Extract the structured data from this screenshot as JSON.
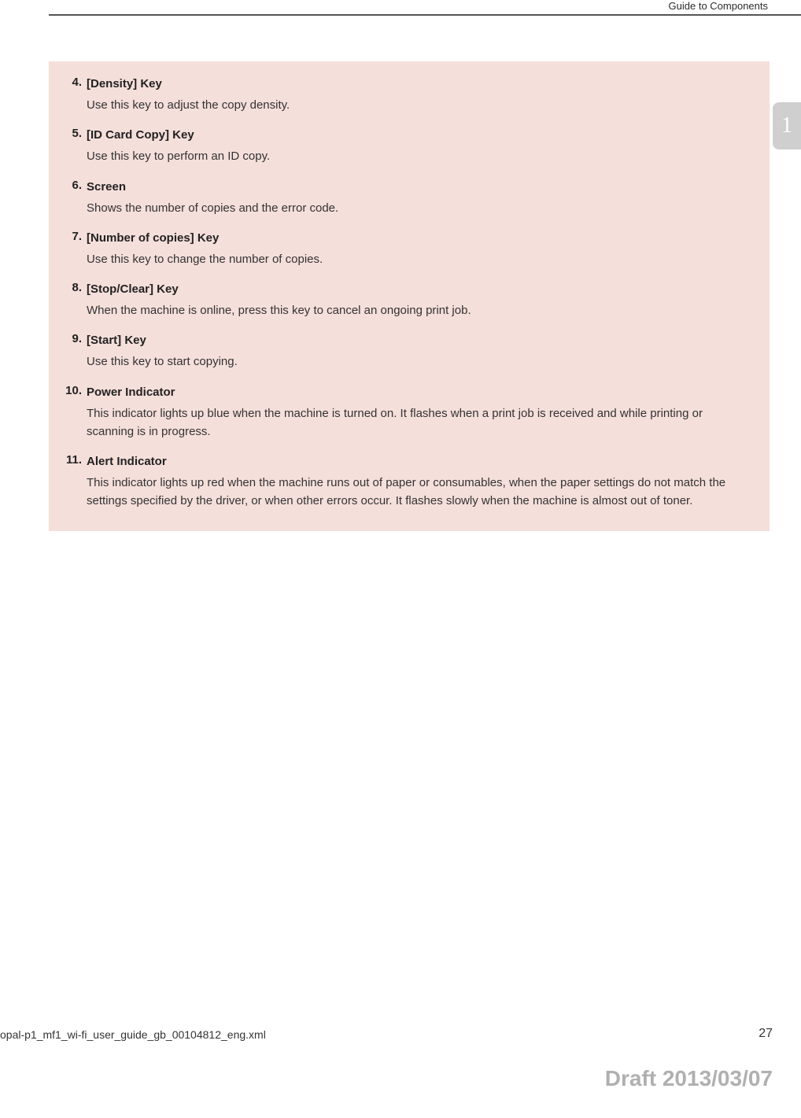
{
  "header": {
    "title": "Guide to Components"
  },
  "sideTab": "1",
  "items": [
    {
      "num": "4.",
      "title": "[Density] Key",
      "desc": "Use this key to adjust the copy density."
    },
    {
      "num": "5.",
      "title": "[ID Card Copy] Key",
      "desc": "Use this key to perform an ID copy."
    },
    {
      "num": "6.",
      "title": "Screen",
      "desc": "Shows the number of copies and the error code."
    },
    {
      "num": "7.",
      "title": "[Number of copies] Key",
      "desc": "Use this key to change the number of copies."
    },
    {
      "num": "8.",
      "title": "[Stop/Clear] Key",
      "desc": "When the machine is online, press this key to cancel an ongoing print job."
    },
    {
      "num": "9.",
      "title": "[Start] Key",
      "desc": "Use this key to start copying."
    },
    {
      "num": "10.",
      "title": "Power Indicator",
      "desc": "This indicator lights up blue when the machine is turned on. It flashes when a print job is received and while printing or scanning is in progress."
    },
    {
      "num": "11.",
      "title": "Alert Indicator",
      "desc": "This indicator lights up red when the machine runs out of paper or consumables, when the paper settings do not match the settings specified by the driver, or when other errors occur. It flashes slowly when the machine is almost out of toner."
    }
  ],
  "footer": {
    "file": "opal-p1_mf1_wi-fi_user_guide_gb_00104812_eng.xml",
    "page": "27",
    "draft": "Draft 2013/03/07"
  }
}
